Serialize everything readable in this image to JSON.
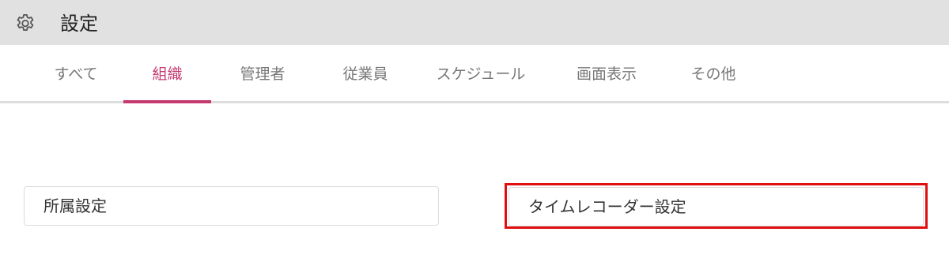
{
  "header": {
    "icon": "gear-icon",
    "title": "設定"
  },
  "tabs": [
    {
      "label": "すべて",
      "active": false
    },
    {
      "label": "組織",
      "active": true
    },
    {
      "label": "管理者",
      "active": false
    },
    {
      "label": "従業員",
      "active": false
    },
    {
      "label": "スケジュール",
      "active": false
    },
    {
      "label": "画面表示",
      "active": false
    },
    {
      "label": "その他",
      "active": false
    }
  ],
  "cards": [
    {
      "label": "所属設定"
    },
    {
      "label": "タイムレコーダー設定",
      "highlighted": true
    }
  ],
  "colors": {
    "header_bg": "#e1e1e1",
    "accent": "#c4396f",
    "highlight_border": "#e01010"
  }
}
